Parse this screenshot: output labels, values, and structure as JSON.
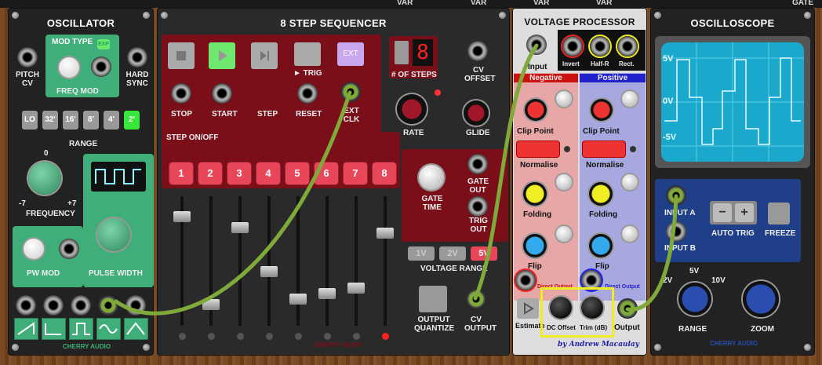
{
  "top_bar": {
    "labels": [
      "VAR",
      "VAR",
      "VAR",
      "VAR",
      "GATE"
    ]
  },
  "oscillator": {
    "title": "OSCILLATOR",
    "mod_type_label": "MOD TYPE",
    "exp_label": "EXP",
    "freq_mod_label": "FREQ MOD",
    "pitch_cv_label": "PITCH CV",
    "hard_sync_label": "HARD SYNC",
    "range_label": "RANGE",
    "range_options": [
      "LO",
      "32'",
      "16'",
      "8'",
      "4'",
      "2'"
    ],
    "range_selected": "2'",
    "frequency_label": "FREQUENCY",
    "freq_zero": "0",
    "freq_min": "-7",
    "freq_max": "+7",
    "pw_mod_label": "PW MOD",
    "pulse_width_label": "PULSE WIDTH",
    "brand": "CHERRY AUDIO",
    "wave_outputs": [
      "sawtooth-up-icon",
      "sawtooth-down-icon",
      "pulse-icon",
      "sine-icon",
      "triangle-icon"
    ]
  },
  "sequencer": {
    "title": "8 STEP SEQUENCER",
    "stop_label": "STOP",
    "start_label": "START",
    "step_label": "STEP",
    "trig_label": "► TRIG",
    "reset_label": "RESET",
    "ext_label": "EXT",
    "ext_clk_label": "EXT CLK",
    "steps_count": "8",
    "num_steps_label": "# OF STEPS",
    "cv_offset_label": "CV OFFSET",
    "rate_label": "RATE",
    "glide_label": "GLIDE",
    "step_on_off_label": "STEP ON/OFF",
    "steps": [
      "1",
      "2",
      "3",
      "4",
      "5",
      "6",
      "7",
      "8"
    ],
    "gate_time_label": "GATE TIME",
    "gate_out_label": "GATE OUT",
    "trig_out_label": "TRIG OUT",
    "voltage_options": [
      "1V",
      "2V",
      "5V"
    ],
    "voltage_selected": "5V",
    "voltage_range_label": "VOLTAGE RANGE",
    "output_quantize_label": "OUTPUT QUANTIZE",
    "cv_output_label": "CV OUTPUT",
    "brand": "CHERRY AUDIO",
    "fader_levels": [
      0.9,
      0.1,
      0.8,
      0.4,
      0.15,
      0.2,
      0.25,
      0.75
    ]
  },
  "voltage_processor": {
    "title": "VOLTAGE PROCESSOR",
    "input_label": "Input",
    "invert_label": "Invert",
    "half_r_label": "Half-R",
    "rect_label": "Rect.",
    "negative_label": "Negative",
    "positive_label": "Positive",
    "clip_point_label": "Clip Point",
    "normalise_label": "Normalise",
    "folding_label": "Folding",
    "flip_label": "Flip",
    "direct_output_label": "Direct Output",
    "estimate_label": "Estimate",
    "dc_offset_label": "DC Offset",
    "trim_label": "Trim (dB)",
    "output_label": "Output",
    "author": "by Andrew Macaulay"
  },
  "oscilloscope": {
    "title": "OSCILLOSCOPE",
    "plus5": "5V",
    "zero": "0V",
    "minus5": "-5V",
    "input_a_label": "INPUT A",
    "input_b_label": "INPUT B",
    "minus_label": "−",
    "plus_label": "+",
    "auto_trig_label": "AUTO TRIG",
    "freeze_label": "FREEZE",
    "range_2v": "2V",
    "range_5v": "5V",
    "range_10v": "10V",
    "range_label": "RANGE",
    "zoom_label": "ZOOM",
    "brand": "CHERRY AUDIO"
  },
  "colors": {
    "cable": "#7faa3a",
    "osc_green": "#3fae79",
    "seq_red": "#7a0f1a",
    "step_red": "#e8475a",
    "scope_screen": "#1aa8cc"
  }
}
